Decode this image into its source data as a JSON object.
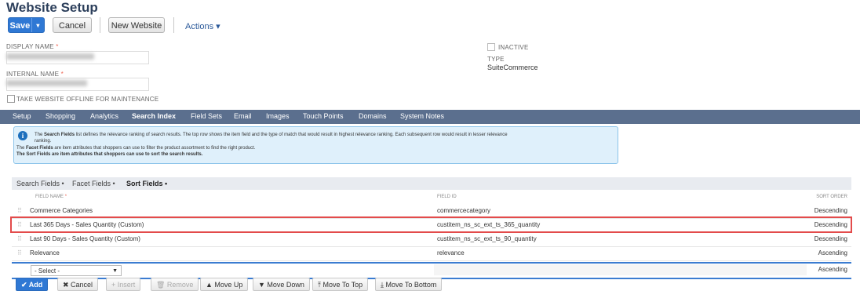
{
  "page": {
    "title": "Website Setup"
  },
  "toolbar": {
    "save_label": "Save",
    "save_arrow": "▾",
    "cancel_label": "Cancel",
    "new_website_label": "New Website",
    "actions_label": "Actions ▾"
  },
  "form": {
    "display_name_label": "DISPLAY NAME",
    "internal_name_label": "INTERNAL NAME",
    "required_mark": "*",
    "offline_label": "TAKE WEBSITE OFFLINE FOR MAINTENANCE",
    "inactive_label": "INACTIVE",
    "type_label": "TYPE",
    "type_value": "SuiteCommerce"
  },
  "tabs": [
    {
      "label": "Setup"
    },
    {
      "label": "Shopping"
    },
    {
      "label": "Analytics"
    },
    {
      "label": "Search Index"
    },
    {
      "label": "Field Sets"
    },
    {
      "label": "Email"
    },
    {
      "label": "Images"
    },
    {
      "label": "Touch Points"
    },
    {
      "label": "Domains"
    },
    {
      "label": "System Notes"
    }
  ],
  "info": {
    "line1a": "The",
    "line1b": "Search Fields",
    "line1c": "list defines the relevance ranking of search results. The top row shows the item field and the type of match that would result in highest relevance ranking. Each subsequent row would result in lesser relevance",
    "line2": "ranking.",
    "line3a": "The",
    "line3b": "Facet Fields",
    "line3c": "are item attributes that shoppers can use to filter the product assortment to find the right product.",
    "line4": "The Sort Fields are item attributes that shoppers can use to sort the search results."
  },
  "subtabs": [
    {
      "label": "Search Fields •"
    },
    {
      "label": "Facet Fields •"
    },
    {
      "label": "Sort Fields •"
    }
  ],
  "table": {
    "headers": {
      "field_name": "FIELD NAME",
      "field_id": "FIELD ID",
      "sort_order": "SORT ORDER"
    },
    "rows": [
      {
        "name": "Commerce Categories",
        "id": "commercecategory",
        "order": "Descending"
      },
      {
        "name": "Last 365 Days - Sales Quantity (Custom)",
        "id": "custitem_ns_sc_ext_ts_365_quantity",
        "order": "Descending"
      },
      {
        "name": "Last 90 Days - Sales Quantity (Custom)",
        "id": "custitem_ns_sc_ext_ts_90_quantity",
        "order": "Descending"
      },
      {
        "name": "Relevance",
        "id": "relevance",
        "order": "Ascending"
      }
    ],
    "edit_row": {
      "select_value": "- Select -",
      "order": "Ascending"
    },
    "grip": "⠿"
  },
  "row_buttons": {
    "add": "✔ Add",
    "cancel": "✖ Cancel",
    "insert": "+ Insert",
    "remove": "🗑 Remove",
    "move_up": "▲ Move Up",
    "move_down": "▼ Move Down",
    "move_top": "⤒ Move To Top",
    "move_bottom": "⤓ Move To Bottom"
  },
  "colors": {
    "accent": "#2f78d4",
    "tabbar": "#5b6f8e",
    "highlight": "#e34b4b"
  }
}
